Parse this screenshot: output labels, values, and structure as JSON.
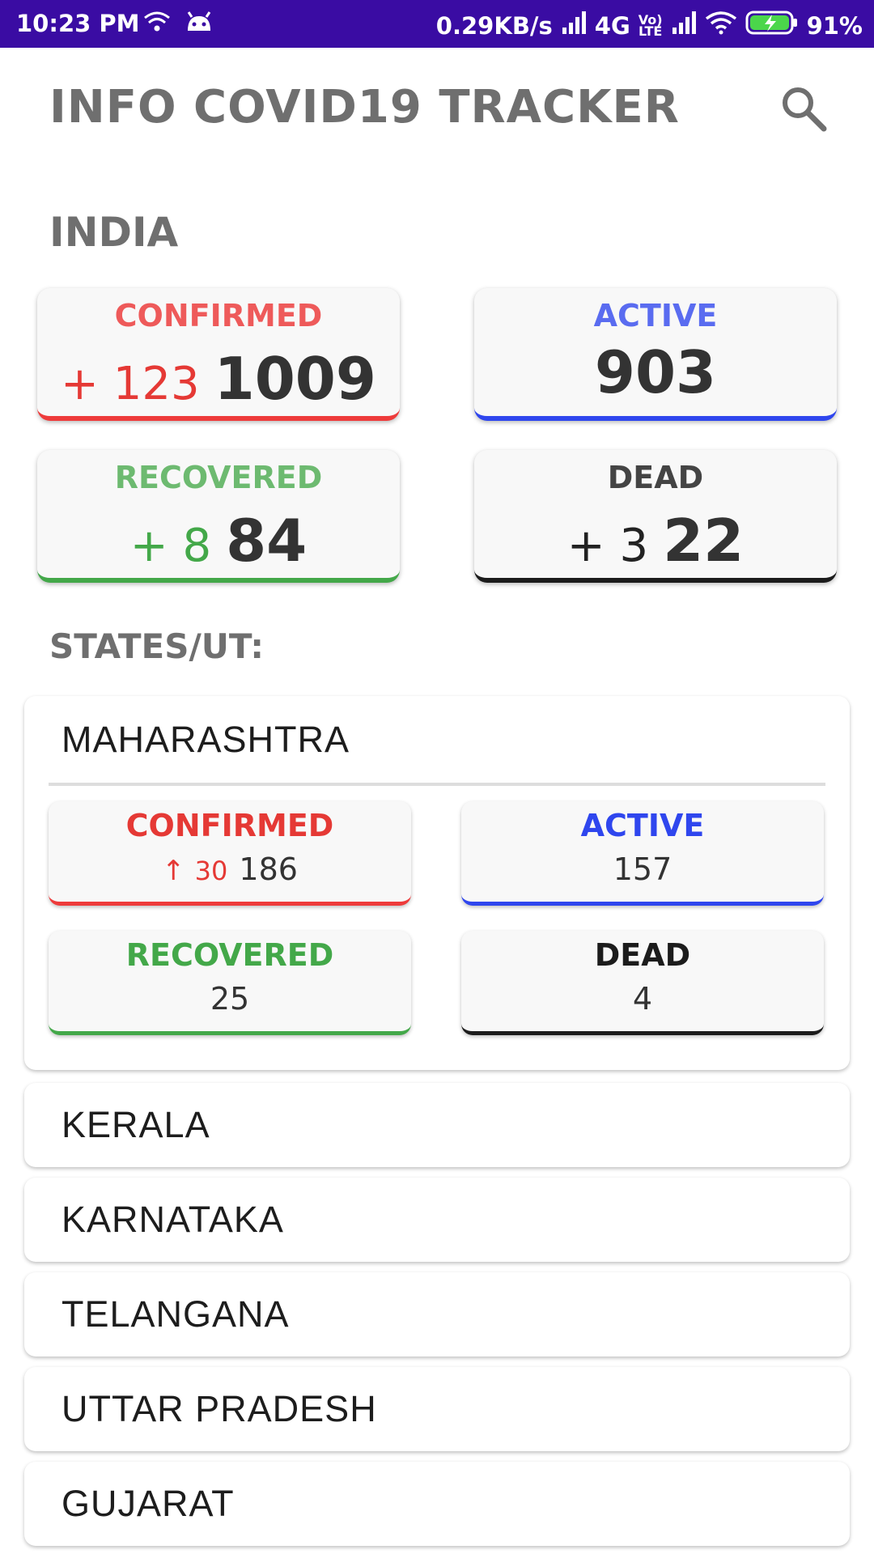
{
  "status_bar": {
    "time": "10:23 PM",
    "speed": "0.29KB/s",
    "network": "4G",
    "volte_top": "Vo)",
    "volte_bottom": "LTE",
    "battery": "91%"
  },
  "app": {
    "title": "INFO COVID19 TRACKER",
    "search_icon": "search-icon"
  },
  "country": {
    "name": "INDIA",
    "confirmed": {
      "label": "CONFIRMED",
      "delta": "+ 123",
      "value": "1009"
    },
    "active": {
      "label": "ACTIVE",
      "value": "903"
    },
    "recovered": {
      "label": "RECOVERED",
      "delta": "+ 8",
      "value": "84"
    },
    "dead": {
      "label": "DEAD",
      "delta": "+ 3",
      "value": "22"
    }
  },
  "states_heading": "STATES/UT:",
  "states": [
    {
      "name": "MAHARASHTRA",
      "confirmed": {
        "label": "CONFIRMED",
        "delta": "30",
        "value": "186"
      },
      "active": {
        "label": "ACTIVE",
        "value": "157"
      },
      "recovered": {
        "label": "RECOVERED",
        "value": "25"
      },
      "dead": {
        "label": "DEAD",
        "value": "4"
      }
    },
    {
      "name": "KERALA"
    },
    {
      "name": "KARNATAKA"
    },
    {
      "name": "TELANGANA"
    },
    {
      "name": "UTTAR PRADESH"
    },
    {
      "name": "GUJARAT"
    }
  ],
  "colors": {
    "status_bar": "#3a0ca3",
    "confirmed": "#ee3b3b",
    "active": "#2f46ee",
    "recovered": "#43a849",
    "dead": "#1c1c1c",
    "heading": "#6f6f6f"
  }
}
